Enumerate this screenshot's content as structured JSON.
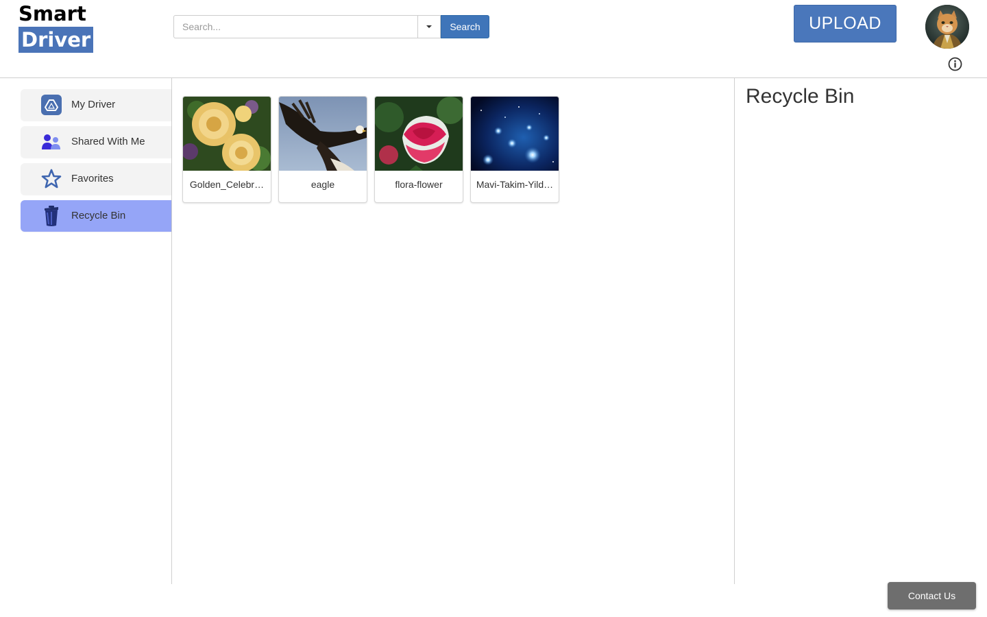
{
  "app": {
    "logo_line1": "Smart",
    "logo_line2": "Driver"
  },
  "search": {
    "placeholder": "Search...",
    "button_label": "Search"
  },
  "header": {
    "upload_label": "UPLOAD"
  },
  "sidebar": {
    "items": [
      {
        "label": "My Driver",
        "icon": "drive-icon",
        "active": false
      },
      {
        "label": "Shared With Me",
        "icon": "users-icon",
        "active": false
      },
      {
        "label": "Favorites",
        "icon": "star-icon",
        "active": false
      },
      {
        "label": "Recycle Bin",
        "icon": "trash-icon",
        "active": true
      }
    ]
  },
  "files": [
    {
      "name": "Golden_Celebration",
      "display": "Golden_Celebr…",
      "thumb": "yellow-roses"
    },
    {
      "name": "eagle",
      "display": "eagle",
      "thumb": "eagle"
    },
    {
      "name": "flora-flower",
      "display": "flora-flower",
      "thumb": "pink-rose"
    },
    {
      "name": "Mavi-Takim-Yildiz",
      "display": "Mavi-Takim-Yild…",
      "thumb": "star-cluster"
    }
  ],
  "details": {
    "title": "Recycle Bin"
  },
  "footer": {
    "contact_label": "Contact Us"
  },
  "colors": {
    "brand_blue": "#4a77bb",
    "active_nav": "#95a5f7",
    "contact_bg": "#6e6e6e"
  }
}
